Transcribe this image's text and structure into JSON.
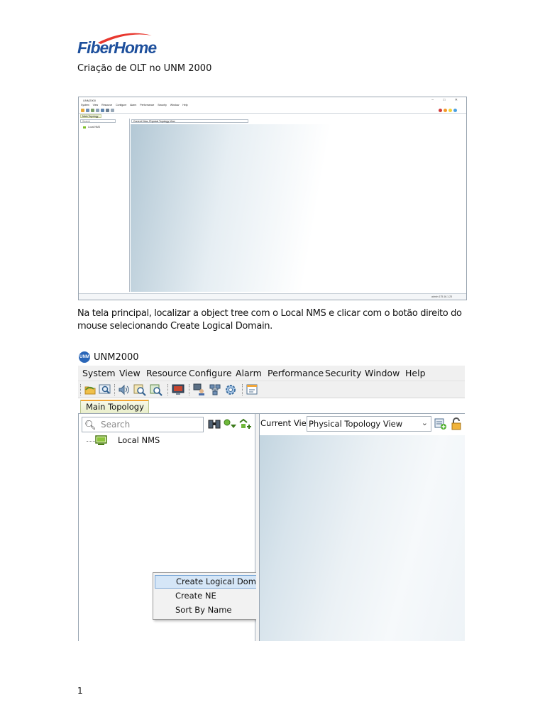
{
  "logo": {
    "text": "FiberHome",
    "accent_color": "#e8372e",
    "text_color": "#1d4f9c"
  },
  "document": {
    "title": "Criação de OLT no UNM 2000",
    "instruction": "Na tela principal, localizar a object tree com o Local NMS e clicar com o botão direito do mouse selecionando Create Logical Domain.",
    "page_number": "1"
  },
  "screenshot_small": {
    "window_title": "UNM2000",
    "window_buttons": "– □ ✕",
    "menu": [
      "System",
      "View",
      "Resource",
      "Configure",
      "Alarm",
      "Performance",
      "Security",
      "Window",
      "Help"
    ],
    "tab": "Main Topology",
    "search_placeholder": "Search",
    "tree_node": "Local NMS",
    "current_view": "Current View: Physical Topology View",
    "status": "admin    175.16.1.23"
  },
  "screenshot_large": {
    "app_logo": "UNM",
    "window_title": "UNM2000",
    "menu": {
      "system": "System",
      "view": "View",
      "resource": "Resource",
      "configure": "Configure",
      "alarm": "Alarm",
      "performance": "Performance",
      "security": "Security",
      "window": "Window",
      "help": "Help"
    },
    "tab": "Main Topology",
    "search_placeholder": "Search",
    "tree_node": "Local NMS",
    "current_view_label": "Current View:",
    "current_view_value": "Physical Topology View",
    "context_menu": {
      "create_logical_domain": "Create Logical Domain...",
      "create_ne": "Create NE",
      "create_ne_arrow": "›",
      "sort_by_name": "Sort By Name"
    }
  },
  "icons": {
    "toolbar": [
      "open-folder-icon",
      "zoom-icon",
      "speaker-icon",
      "find-icon",
      "find-alarm-icon",
      "monitor-icon",
      "users-icon",
      "network-icon",
      "settings-icon",
      "window-icon"
    ],
    "left_panel": [
      "binoculars-icon",
      "filter-icon",
      "tree-filter-icon"
    ],
    "right_panel": [
      "add-view-icon",
      "lock-icon"
    ]
  }
}
